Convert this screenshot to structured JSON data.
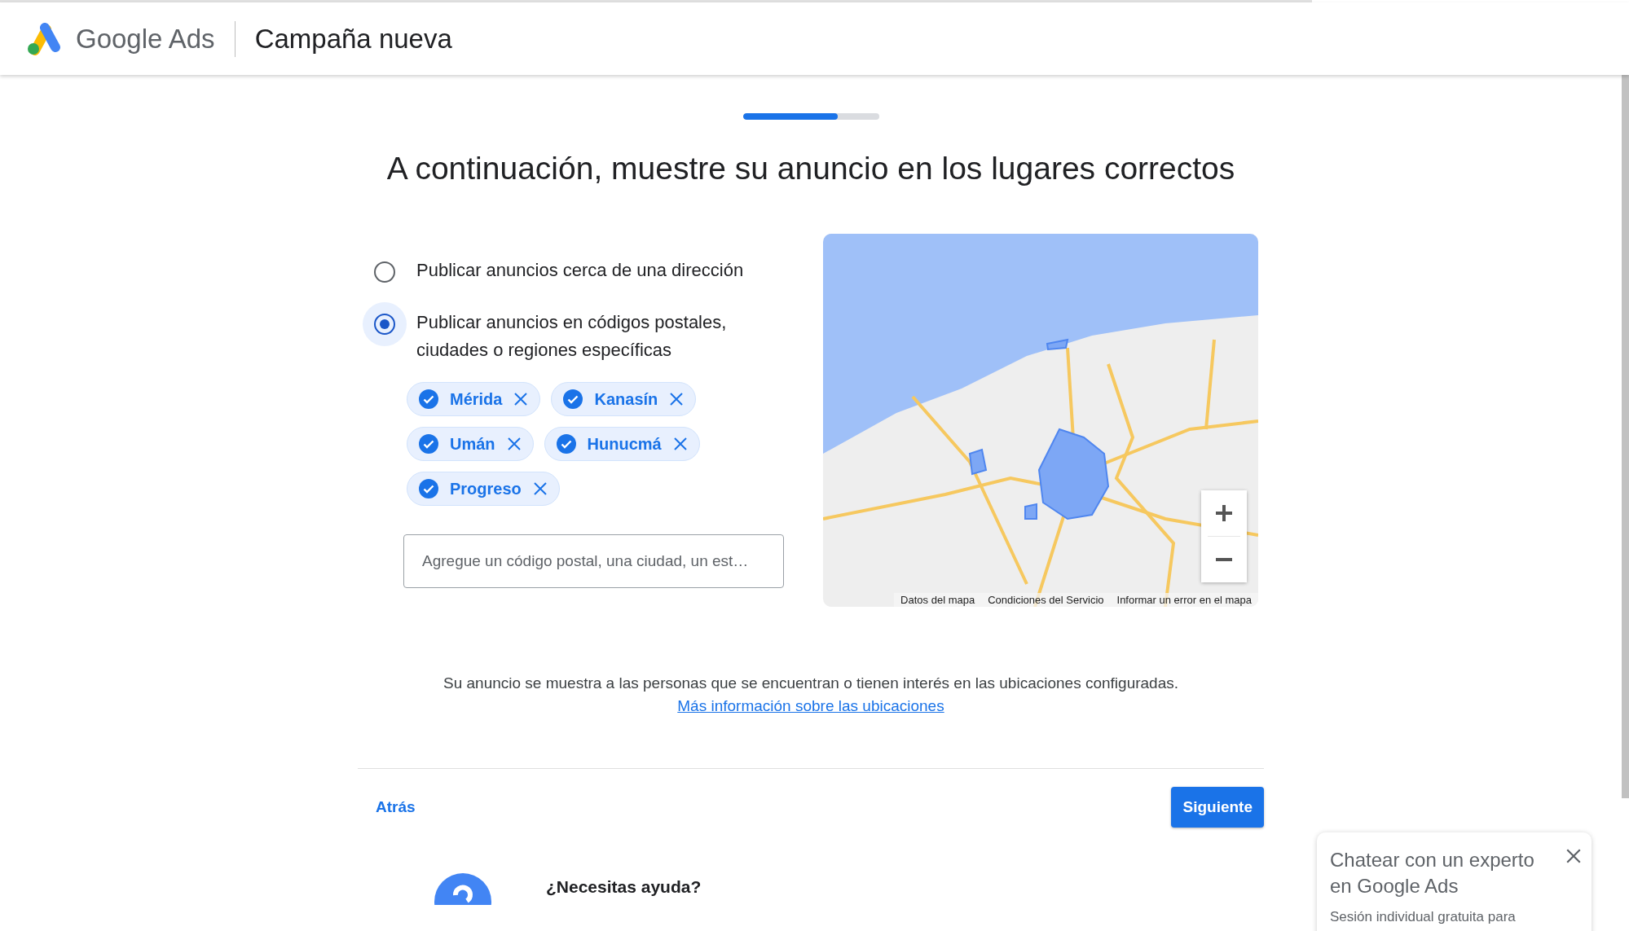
{
  "header": {
    "brand": "Google Ads",
    "title": "Campaña nueva"
  },
  "progress": {
    "level": 0.7
  },
  "heading": "A continuación, muestre su anuncio en los lugares correctos",
  "options": [
    {
      "label": "Publicar anuncios cerca de una dirección",
      "selected": false
    },
    {
      "label": "Publicar anuncios en códigos postales, ciudades o regiones específicas",
      "selected": true
    }
  ],
  "locations": [
    "Mérida",
    "Kanasín",
    "Umán",
    "Hunucmá",
    "Progreso"
  ],
  "search": {
    "placeholder": "Agregue un código postal, una ciudad, un est…"
  },
  "map": {
    "kind": "picture",
    "attribution": [
      "Datos del mapa",
      "Condiciones del Servicio",
      "Informar un error en el mapa"
    ]
  },
  "info": {
    "text": "Su anuncio se muestra a las personas que se encuentran o tienen interés en las ubicaciones configuradas.",
    "link": "Más información sobre las ubicaciones"
  },
  "nav": {
    "back": "Atrás",
    "next": "Siguiente"
  },
  "help": {
    "title": "¿Necesitas ayuda?"
  },
  "chat": {
    "title": "Chatear con un experto en Google Ads",
    "subtitle": "Sesión individual gratuita para"
  }
}
